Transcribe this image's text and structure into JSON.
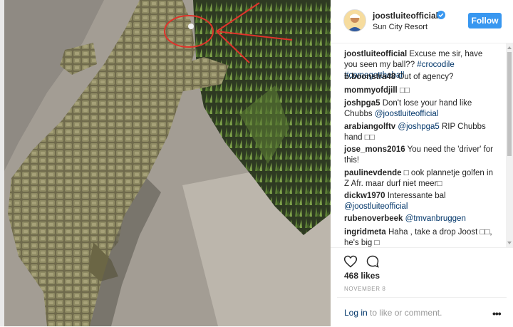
{
  "post": {
    "username": "joostluiteofficial",
    "location": "Sun City Resort",
    "follow_label": "Follow"
  },
  "comments": [
    {
      "user": "joostluiteofficial",
      "text": "Excuse me sir, have you seen my ball?? ",
      "tags": "#crocodile #comegettheball"
    },
    {
      "user": "b.boonstra48",
      "text": "Out of agency?",
      "tags": ""
    },
    {
      "user": "mommyofdjill",
      "text": "□□",
      "tags": ""
    },
    {
      "user": "joshpga5",
      "text": "Don't lose your hand like Chubbs ",
      "tags": "@joostluiteofficial"
    },
    {
      "user": "arabiangolftv",
      "text": " RIP Chubbs hand □□",
      "tags": "@joshpga5"
    },
    {
      "user": "jose_mons2016",
      "text": "You need the 'driver' for this!",
      "tags": ""
    },
    {
      "user": "paulinevdende",
      "text": "□ ook plannetje golfen in Z Afr. maar durf niet meer□",
      "tags": ""
    },
    {
      "user": "dickw1970",
      "text": "Interessante bal ",
      "tags": "@joostluiteofficial"
    },
    {
      "user": "rubenoverbeek",
      "text": " ",
      "tags": "@tmvanbruggen"
    },
    {
      "user": "ingridmeta",
      "text": "Haha , take a drop Joost □□, he's big □",
      "tags": ""
    }
  ],
  "likes": "468 likes",
  "date": "NOVEMBER 8",
  "footer": {
    "login_link": "Log in",
    "login_rest": " to like or comment.",
    "more": "•••"
  },
  "icons": {
    "heart": "heart-icon",
    "comment": "comment-icon",
    "verified": "verified-badge-icon",
    "more": "more-options-icon"
  },
  "colors": {
    "follow": "#3897f0",
    "link": "#003569",
    "verified": "#3897f0",
    "annotation": "#e0332b"
  }
}
